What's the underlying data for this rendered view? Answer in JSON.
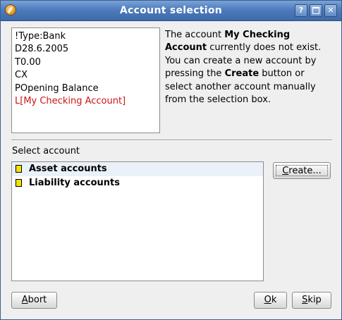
{
  "window": {
    "title": "Account selection"
  },
  "titlebar": {
    "help_label": "?",
    "close_label": "✕"
  },
  "qif_lines": [
    "!Type:Bank",
    "D28.6.2005",
    "T0.00",
    "CX",
    "POpening Balance",
    "L[My Checking Account]"
  ],
  "message": {
    "part1": "The account ",
    "account_name": "My Checking Account",
    "part2": " currently does not exist. You can create a new account by pressing the ",
    "create_word": "Create",
    "part3": " button or select another account manually from the selection box."
  },
  "select_label": "Select account",
  "accounts": [
    {
      "label": "Asset accounts"
    },
    {
      "label": "Liability accounts"
    }
  ],
  "buttons": {
    "create": {
      "mnemonic": "C",
      "rest": "reate..."
    },
    "abort": {
      "mnemonic": "A",
      "rest": "bort"
    },
    "ok": {
      "mnemonic": "O",
      "rest": "k"
    },
    "skip": {
      "mnemonic": "S",
      "rest": "kip"
    }
  },
  "colors": {
    "titlebar": "#4d7bbd",
    "missing_account_text": "#cc1414",
    "folder_icon": "#f1e20a"
  }
}
